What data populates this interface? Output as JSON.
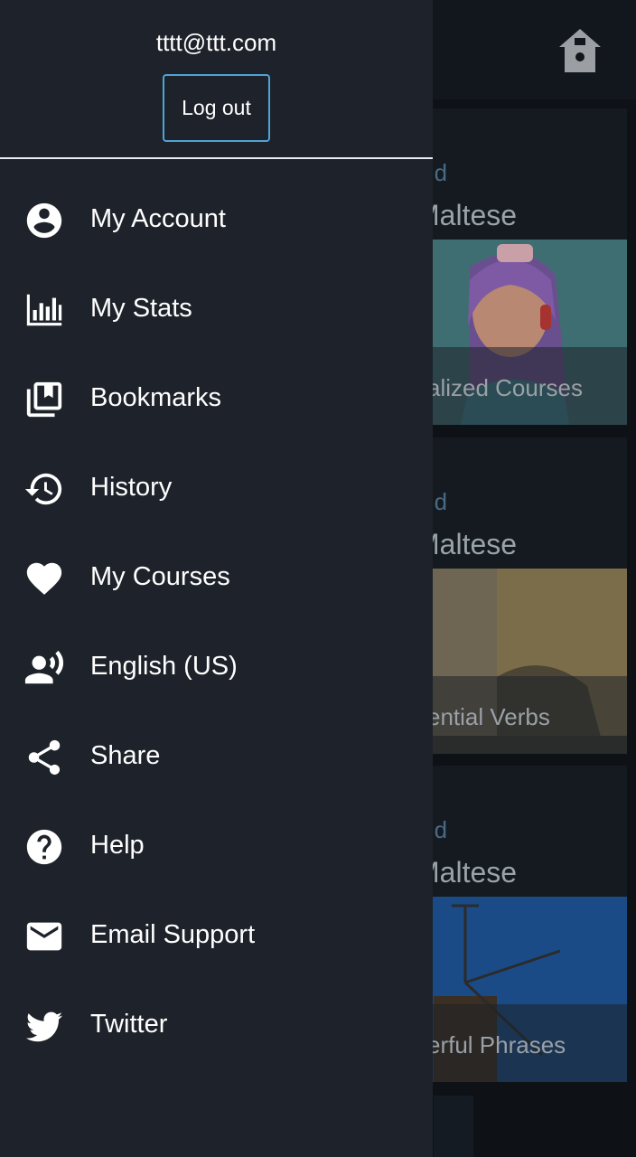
{
  "drawer": {
    "email": "tttt@ttt.com",
    "logout_label": "Log out",
    "items": [
      {
        "label": "My Account",
        "icon": "account-circle-icon"
      },
      {
        "label": "My Stats",
        "icon": "bar-chart-icon"
      },
      {
        "label": "Bookmarks",
        "icon": "bookmarks-icon"
      },
      {
        "label": "History",
        "icon": "history-icon"
      },
      {
        "label": "My Courses",
        "icon": "heart-icon"
      },
      {
        "label": "English (US)",
        "icon": "voice-language-icon"
      },
      {
        "label": "Share",
        "icon": "share-icon"
      },
      {
        "label": "Help",
        "icon": "help-icon"
      },
      {
        "label": "Email Support",
        "icon": "mail-icon"
      },
      {
        "label": "Twitter",
        "icon": "twitter-icon"
      }
    ]
  },
  "background": {
    "home_icon": "home-icon",
    "cards": [
      {
        "kicker": "d",
        "title": "Maltese",
        "caption": "alized Courses"
      },
      {
        "kicker": "d",
        "title": "Maltese",
        "caption": "ential Verbs"
      },
      {
        "kicker": "d",
        "title": "Maltese",
        "caption": "erful Phrases"
      }
    ]
  },
  "colors": {
    "drawer_bg": "#1e232b",
    "accent_border": "#4fa3d6",
    "text": "#ffffff"
  }
}
